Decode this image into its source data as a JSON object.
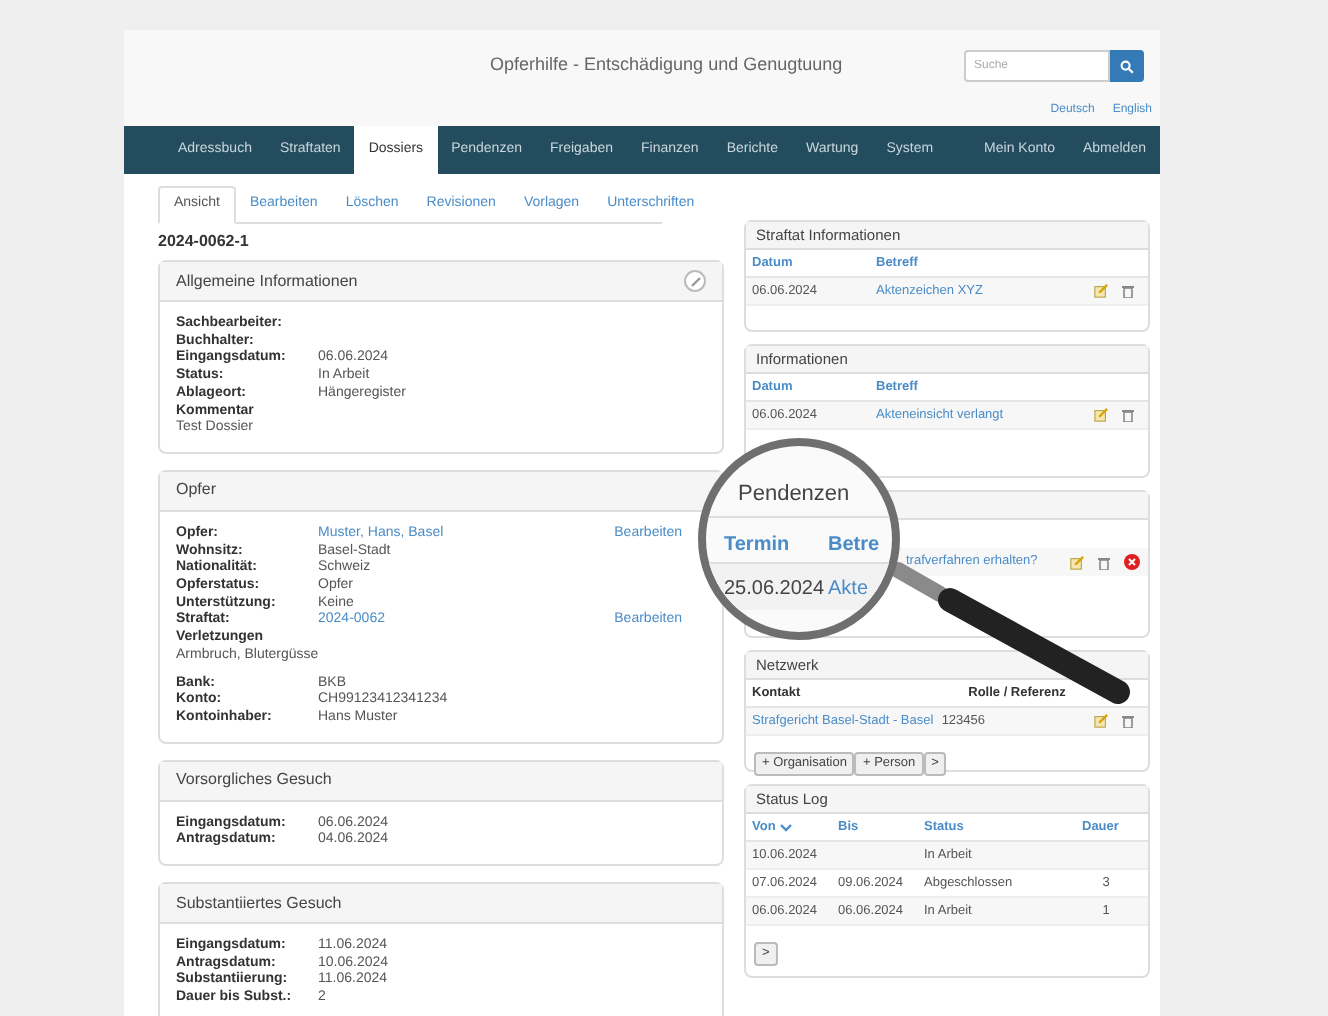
{
  "header": {
    "title": "Opferhilfe - Entschädigung und Genugtuung",
    "search": {
      "placeholder": "Suche"
    },
    "languages": [
      "Deutsch",
      "English"
    ]
  },
  "nav": {
    "items": [
      {
        "label": "Adressbuch",
        "selected": false
      },
      {
        "label": "Straftaten",
        "selected": false
      },
      {
        "label": "Dossiers",
        "selected": true
      },
      {
        "label": "Pendenzen",
        "selected": false
      },
      {
        "label": "Freigaben",
        "selected": false
      },
      {
        "label": "Finanzen",
        "selected": false
      },
      {
        "label": "Berichte",
        "selected": false
      },
      {
        "label": "Wartung",
        "selected": false
      },
      {
        "label": "System",
        "selected": false
      }
    ],
    "right": [
      "Mein Konto",
      "Abmelden"
    ]
  },
  "tabs": [
    {
      "label": "Ansicht",
      "selected": true
    },
    {
      "label": "Bearbeiten",
      "selected": false
    },
    {
      "label": "Löschen",
      "selected": false
    },
    {
      "label": "Revisionen",
      "selected": false
    },
    {
      "label": "Vorlagen",
      "selected": false
    },
    {
      "label": "Unterschriften",
      "selected": false
    }
  ],
  "dossier_id": "2024-0062-1",
  "left_panels": [
    {
      "title": "Allgemeine Informationen",
      "editable": true,
      "rows": [
        {
          "kind": "field",
          "label": "Sachbearbeiter:"
        },
        {
          "kind": "field",
          "label": "Buchhalter:"
        },
        {
          "kind": "field",
          "label": "Eingangsdatum:",
          "value": "06.06.2024"
        },
        {
          "kind": "field",
          "label": "Status:",
          "value": "In Arbeit"
        },
        {
          "kind": "field",
          "label": "Ablageort:",
          "value": "Hängeregister"
        },
        {
          "kind": "field",
          "label": "Kommentar"
        },
        {
          "kind": "text",
          "value": "Test Dossier"
        }
      ]
    },
    {
      "title": "Opfer",
      "editable": false,
      "rows": [
        {
          "kind": "field",
          "label": "Opfer:",
          "value": "Muster, Hans, Basel",
          "link": true,
          "action": "Bearbeiten"
        },
        {
          "kind": "field",
          "label": "Wohnsitz:",
          "value": "Basel-Stadt",
          "link": false
        },
        {
          "kind": "field",
          "label": "Nationalität:",
          "value": "Schweiz",
          "link": false
        },
        {
          "kind": "field",
          "label": "Opferstatus:",
          "value": "Opfer",
          "link": false
        },
        {
          "kind": "field",
          "label": "Unterstützung:",
          "value": "Keine",
          "link": false
        },
        {
          "kind": "field",
          "label": "Straftat:",
          "value": "2024-0062",
          "link": true,
          "action": "Bearbeiten"
        },
        {
          "kind": "field",
          "label": "Verletzungen"
        },
        {
          "kind": "text",
          "value": "Armbruch, Blutergüsse"
        },
        {
          "kind": "gap"
        },
        {
          "kind": "field",
          "label": "Bank:",
          "value": "BKB",
          "link": false
        },
        {
          "kind": "field",
          "label": "Konto:",
          "value": "CH99123412341234",
          "link": false
        },
        {
          "kind": "field",
          "label": "Kontoinhaber:",
          "value": "Hans Muster",
          "link": false
        }
      ]
    },
    {
      "title": "Vorsorgliches Gesuch",
      "editable": false,
      "rows": [
        {
          "kind": "field",
          "label": "Eingangsdatum:",
          "value": "06.06.2024"
        },
        {
          "kind": "field",
          "label": "Antragsdatum:",
          "value": "04.06.2024"
        }
      ]
    },
    {
      "title": "Substantiiertes Gesuch",
      "editable": false,
      "rows": [
        {
          "kind": "field",
          "label": "Eingangsdatum:",
          "value": "11.06.2024"
        },
        {
          "kind": "field",
          "label": "Antragsdatum:",
          "value": "10.06.2024"
        },
        {
          "kind": "field",
          "label": "Substantiierung:",
          "value": "11.06.2024"
        },
        {
          "kind": "field",
          "label": "Dauer bis Subst.:",
          "value": "2"
        }
      ]
    }
  ],
  "right_panels": [
    {
      "kind": "table",
      "title": "Straftat Informationen",
      "columns": [
        {
          "label": "Datum",
          "sortable": true
        },
        {
          "label": "Betreff",
          "sortable": true
        }
      ],
      "rows": [
        {
          "cells": [
            {
              "text": "06.06.2024",
              "link": false
            },
            {
              "text": "Aktenzeichen XYZ",
              "link": true
            }
          ],
          "editable": true,
          "removable": false
        }
      ]
    },
    {
      "kind": "table",
      "title": "Informationen",
      "columns": [
        {
          "label": "Datum",
          "sortable": true
        },
        {
          "label": "Betreff",
          "sortable": true
        }
      ],
      "rows": [
        {
          "cells": [
            {
              "text": "06.06.2024",
              "link": false
            },
            {
              "text": "Akteneinsicht verlangt",
              "link": true
            }
          ],
          "editable": true,
          "removable": false
        }
      ]
    },
    {
      "kind": "obscured",
      "rows": [
        {
          "cells": [
            {
              "text": "trafverfahren erhalten?",
              "link": true
            }
          ],
          "editable": true,
          "removable": true
        }
      ]
    },
    {
      "kind": "table",
      "title": "Netzwerk",
      "columns": [
        {
          "label": "Kontakt",
          "sortable": false
        },
        {
          "label": "Rolle / Referenz",
          "sortable": false
        }
      ],
      "rows": [
        {
          "cells": [
            {
              "text": "Strafgericht Basel-Stadt - Basel",
              "link": true
            },
            {
              "text": "123456",
              "link": false
            }
          ],
          "editable": true,
          "removable": false
        }
      ],
      "buttons": [
        "+ Organisation",
        "+ Person",
        ">"
      ]
    },
    {
      "kind": "table",
      "title": "Status Log",
      "columns": [
        {
          "label": "Von",
          "sortable": true,
          "sorted": true
        },
        {
          "label": "Bis",
          "sortable": true,
          "sorted": false
        },
        {
          "label": "Status",
          "sortable": true,
          "sorted": false
        },
        {
          "label": "Dauer",
          "sortable": true,
          "sorted": false
        }
      ],
      "rows": [
        {
          "cells": [
            {
              "text": "10.06.2024",
              "link": false
            },
            {},
            {
              "text": "In Arbeit",
              "link": false
            },
            {}
          ],
          "editable": false,
          "removable": false
        },
        {
          "cells": [
            {
              "text": "07.06.2024",
              "link": false
            },
            {
              "text": "09.06.2024",
              "link": false
            },
            {
              "text": "Abgeschlossen",
              "link": false
            },
            {
              "text": "3",
              "link": false
            }
          ],
          "editable": false,
          "removable": false
        },
        {
          "cells": [
            {
              "text": "06.06.2024",
              "link": false
            },
            {
              "text": "06.06.2024",
              "link": false
            },
            {
              "text": "In Arbeit",
              "link": false
            },
            {
              "text": "1",
              "link": false
            }
          ],
          "editable": false,
          "removable": false
        }
      ],
      "buttons": [
        ">"
      ]
    }
  ],
  "magnifier": {
    "title": "Pendenzen",
    "columns": [
      "Termin",
      "Betre"
    ],
    "cells": [
      "25.06.2024",
      "Akte"
    ]
  }
}
